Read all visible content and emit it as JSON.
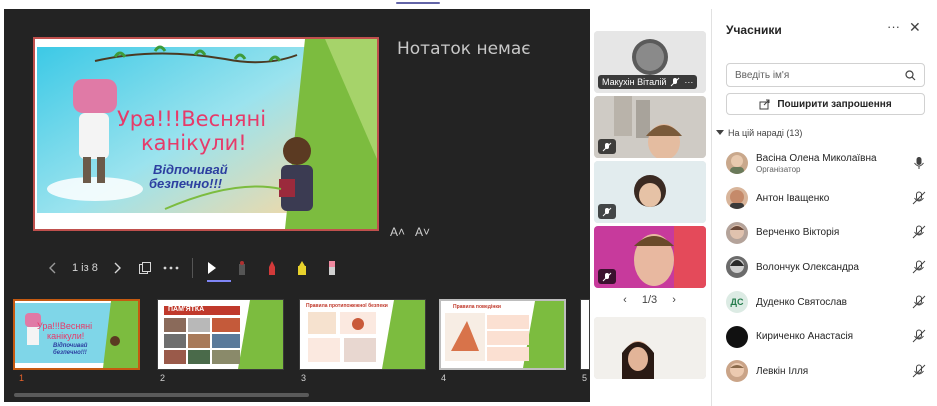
{
  "presenter": {
    "notes_text": "Нотаток немає",
    "font_increase": "A˄",
    "font_decrease": "A˅",
    "slide_counter": "1 із 8",
    "current_slide": {
      "title_line1": "Ура!!!Весняні",
      "title_line2": "канікули!",
      "subtitle_line1": "Відпочивай",
      "subtitle_line2": "безпечно!!!"
    },
    "thumbnails": [
      {
        "number": "1",
        "title_line1": "Ура!!!Весняні",
        "title_line2": "канікули!",
        "subtitle_line1": "Відпочивай",
        "subtitle_line2": "безпечно!!!"
      },
      {
        "number": "2",
        "banner": "ПАМ'ЯТКА"
      },
      {
        "number": "3",
        "heading": "Правила протипожежної безпеки"
      },
      {
        "number": "4",
        "heading": "Правила поведінки"
      },
      {
        "number": "5"
      }
    ],
    "colors": {
      "slide_green": "#7cbc3f",
      "selected_border": "#c55a11",
      "main_slide_border": "#c0504d"
    }
  },
  "videos": {
    "tiles": [
      {
        "name": "Макухін Віталій",
        "muted": true,
        "more": "···"
      },
      {
        "muted": true
      },
      {
        "muted": true
      },
      {
        "muted": true
      },
      {}
    ],
    "pager": {
      "label": "1/3",
      "prev": "‹",
      "next": "›"
    }
  },
  "participants_panel": {
    "title": "Учасники",
    "more_icon": "···",
    "close_icon": "✕",
    "search_placeholder": "Введіть ім'я",
    "invite_label": "Поширити запрошення",
    "section_label": "На цій нараді (13)",
    "people": [
      {
        "name": "Васіна Олена Миколаївна",
        "role": "Організатор",
        "initials": "",
        "avatar_color": "#c9a88c",
        "mic": "on"
      },
      {
        "name": "Антон Іващенко",
        "role": "",
        "initials": "",
        "avatar_color": "#d8b59b",
        "mic": "off"
      },
      {
        "name": "Верченко Вікторія",
        "role": "",
        "initials": "",
        "avatar_color": "#b4a39a",
        "mic": "off"
      },
      {
        "name": "Волончук Олександра",
        "role": "",
        "initials": "",
        "avatar_color": "#6b6b6b",
        "mic": "off"
      },
      {
        "name": "Дуденко Святослав",
        "role": "",
        "initials": "ДС",
        "avatar_color": "#dcebe4",
        "mic": "off"
      },
      {
        "name": "Кириченко Анастасія",
        "role": "",
        "initials": "",
        "avatar_color": "#111111",
        "mic": "off"
      },
      {
        "name": "Левкін Ілля",
        "role": "",
        "initials": "",
        "avatar_color": "#caa488",
        "mic": "off"
      }
    ]
  }
}
